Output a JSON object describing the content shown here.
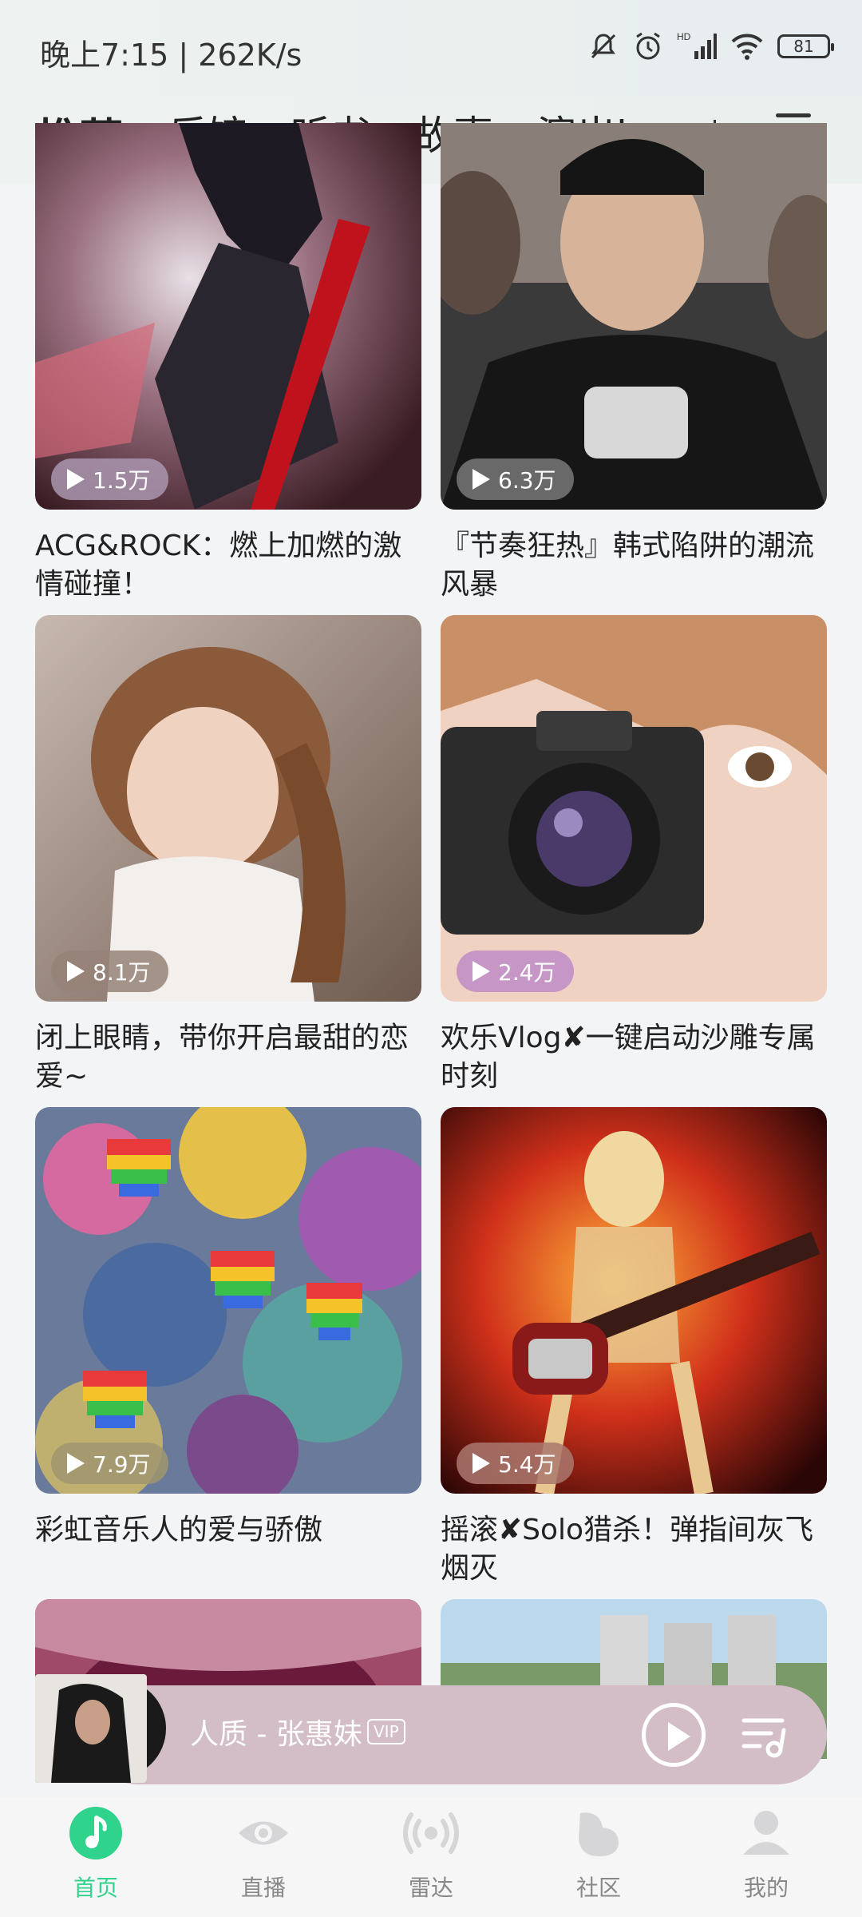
{
  "status_bar": {
    "time": "晚上7:15 | 262K/s",
    "battery": "81",
    "icons": [
      "mute-bell-icon",
      "alarm-icon",
      "hd-signal-icon",
      "wifi-icon",
      "battery-icon"
    ]
  },
  "top_tabs": {
    "items": [
      {
        "label": "推荐",
        "active": true
      },
      {
        "label": "乐馆",
        "active": false
      },
      {
        "label": "听书",
        "active": false
      },
      {
        "label": "故事",
        "active": false
      },
      {
        "label": "演出ing",
        "active": false
      }
    ],
    "accent": "#2fd38c"
  },
  "cards": [
    {
      "title": "ACG&ROCK：燃上加燃的激情碰撞！",
      "plays": "1.5万"
    },
    {
      "title": "『节奏狂热』韩式陷阱的潮流风暴",
      "plays": "6.3万"
    },
    {
      "title": "闭上眼睛，带你开启最甜的恋爱~",
      "plays": "8.1万"
    },
    {
      "title": "欢乐Vlog✘一键启动沙雕专属时刻",
      "plays": "2.4万"
    },
    {
      "title": "彩虹音乐人的爱与骄傲",
      "plays": "7.9万"
    },
    {
      "title": "摇滚✘Solo猎杀！弹指间灰飞烟灭",
      "plays": "5.4万"
    }
  ],
  "mini_player": {
    "song": "人质 - 张惠妹",
    "vip": "VIP"
  },
  "bottom_nav": [
    {
      "label": "首页",
      "icon": "music-note-icon"
    },
    {
      "label": "直播",
      "icon": "eye-icon"
    },
    {
      "label": "雷达",
      "icon": "radar-icon"
    },
    {
      "label": "社区",
      "icon": "community-icon"
    },
    {
      "label": "我的",
      "icon": "profile-icon"
    }
  ]
}
